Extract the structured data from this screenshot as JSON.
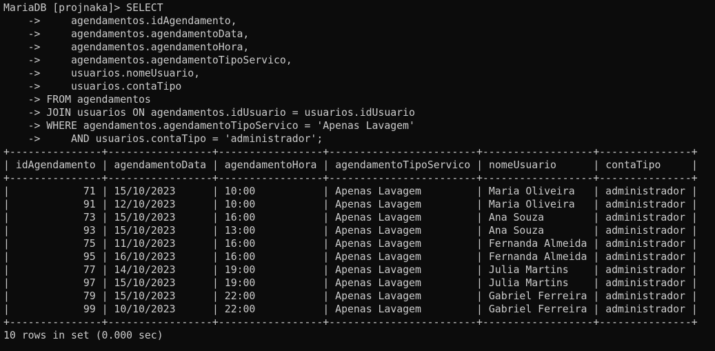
{
  "prompt": "MariaDB [projnaka]> ",
  "continuation_prompt": "    -> ",
  "query": {
    "first_line": "SELECT",
    "lines": [
      "    agendamentos.idAgendamento,",
      "    agendamentos.agendamentoData,",
      "    agendamentos.agendamentoHora,",
      "    agendamentos.agendamentoTipoServico,",
      "    usuarios.nomeUsuario,",
      "    usuarios.contaTipo",
      "FROM agendamentos",
      "JOIN usuarios ON agendamentos.idUsuario = usuarios.idUsuario",
      "WHERE agendamentos.agendamentoTipoServico = 'Apenas Lavagem'",
      "    AND usuarios.contaTipo = 'administrador';"
    ]
  },
  "result": {
    "columns": [
      "idAgendamento",
      "agendamentoData",
      "agendamentoHora",
      "agendamentoTipoServico",
      "nomeUsuario",
      "contaTipo"
    ],
    "rows": [
      [
        "71",
        "15/10/2023",
        "10:00",
        "Apenas Lavagem",
        "Maria Oliveira",
        "administrador"
      ],
      [
        "91",
        "12/10/2023",
        "10:00",
        "Apenas Lavagem",
        "Maria Oliveira",
        "administrador"
      ],
      [
        "73",
        "15/10/2023",
        "16:00",
        "Apenas Lavagem",
        "Ana Souza",
        "administrador"
      ],
      [
        "93",
        "15/10/2023",
        "13:00",
        "Apenas Lavagem",
        "Ana Souza",
        "administrador"
      ],
      [
        "75",
        "11/10/2023",
        "16:00",
        "Apenas Lavagem",
        "Fernanda Almeida",
        "administrador"
      ],
      [
        "95",
        "16/10/2023",
        "16:00",
        "Apenas Lavagem",
        "Fernanda Almeida",
        "administrador"
      ],
      [
        "77",
        "14/10/2023",
        "19:00",
        "Apenas Lavagem",
        "Julia Martins",
        "administrador"
      ],
      [
        "97",
        "15/10/2023",
        "19:00",
        "Apenas Lavagem",
        "Julia Martins",
        "administrador"
      ],
      [
        "79",
        "15/10/2023",
        "22:00",
        "Apenas Lavagem",
        "Gabriel Ferreira",
        "administrador"
      ],
      [
        "99",
        "10/10/2023",
        "22:00",
        "Apenas Lavagem",
        "Gabriel Ferreira",
        "administrador"
      ]
    ],
    "footer": "10 rows in set (0.000 sec)"
  },
  "colors": {
    "background": "#0c0c0c",
    "text": "#cccccc"
  }
}
